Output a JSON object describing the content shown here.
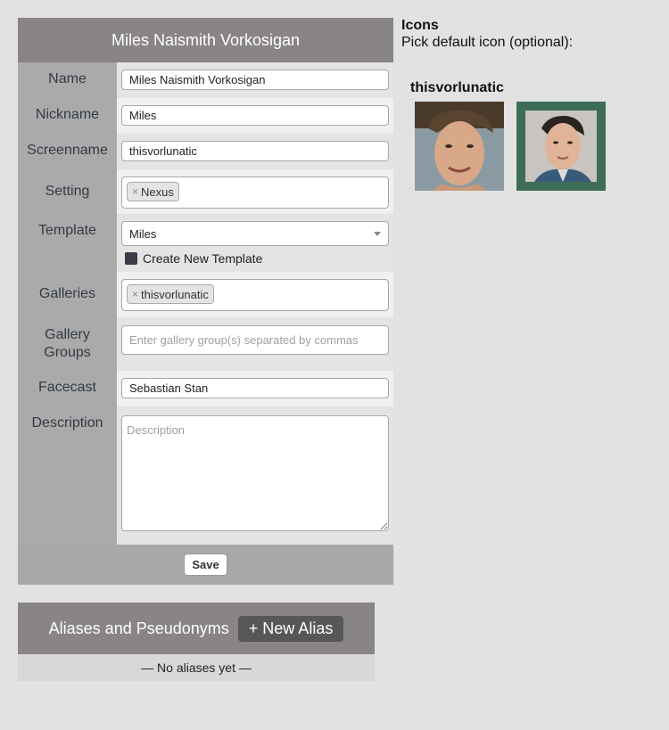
{
  "form": {
    "header_title": "Miles Naismith Vorkosigan",
    "name_label": "Name",
    "name_value": "Miles Naismith Vorkosigan",
    "nickname_label": "Nickname",
    "nickname_value": "Miles",
    "screenname_label": "Screenname",
    "screenname_value": "thisvorlunatic",
    "setting_label": "Setting",
    "setting_tag": "Nexus",
    "template_label": "Template",
    "template_value": "Miles",
    "create_template_label": "Create New Template",
    "galleries_label": "Galleries",
    "galleries_tag": "thisvorlunatic",
    "gallery_groups_label_1": "Gallery",
    "gallery_groups_label_2": "Groups",
    "gallery_groups_placeholder": "Enter gallery group(s) separated by commas",
    "facecast_label": "Facecast",
    "facecast_value": "Sebastian Stan",
    "description_label": "Description",
    "description_placeholder": "Description",
    "save_label": "Save",
    "tag_remove_glyph": "×"
  },
  "aliases": {
    "title": "Aliases and Pseudonyms",
    "new_alias_label": "+ New Alias",
    "empty_text": "— No aliases yet —"
  },
  "icons": {
    "title": "Icons",
    "subtitle": "Pick default icon (optional):",
    "gallery_name": "thisvorlunatic",
    "selected_index": 1,
    "selection_color": "#3e6d57"
  }
}
